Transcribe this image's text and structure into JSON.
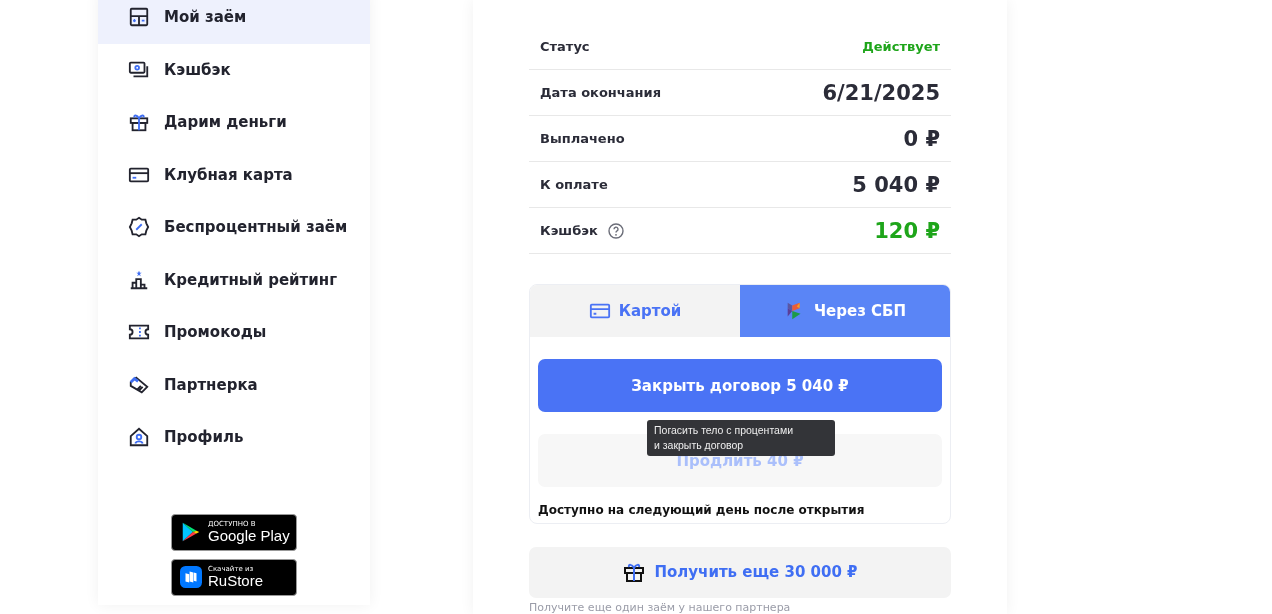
{
  "sidebar": {
    "items": [
      {
        "label": "Мой заём",
        "selected": true
      },
      {
        "label": "Кэшбэк",
        "selected": false
      },
      {
        "label": "Дарим деньги",
        "selected": false
      },
      {
        "label": "Клубная карта",
        "selected": false
      },
      {
        "label": "Беспроцентный заём",
        "selected": false
      },
      {
        "label": "Кредитный рейтинг",
        "selected": false
      },
      {
        "label": "Промокоды",
        "selected": false
      },
      {
        "label": "Партнерка",
        "selected": false
      },
      {
        "label": "Профиль",
        "selected": false
      }
    ],
    "store_badges": [
      {
        "kind": "google",
        "caption": "ДОСТУПНО В",
        "name": "Google Play"
      },
      {
        "kind": "rustore",
        "caption": "Скачайте из",
        "name": "RuStore"
      }
    ]
  },
  "loan": {
    "rows": [
      {
        "label": "Статус",
        "value": "Действует",
        "kind": "status",
        "positive": true,
        "help": false
      },
      {
        "label": "Дата окончания",
        "value": "6/21/2025",
        "kind": "amount",
        "positive": false,
        "help": false
      },
      {
        "label": "Выплачено",
        "value": "0 ₽",
        "kind": "amount",
        "positive": false,
        "help": false
      },
      {
        "label": "К оплате",
        "value": "5 040 ₽",
        "kind": "amount",
        "positive": false,
        "help": false
      },
      {
        "label": "Кэшбэк",
        "value": "120 ₽",
        "kind": "amount",
        "positive": true,
        "help": true
      }
    ],
    "payment_tabs": [
      {
        "label": "Картой",
        "kind": "card",
        "selected": false
      },
      {
        "label": "Через СБП",
        "kind": "sbp",
        "selected": true
      }
    ],
    "close_button": "Закрыть договор 5 040 ₽",
    "extend_button": {
      "label": "Продлить 40 ₽",
      "disabled": true
    },
    "tooltip": [
      "Погасить тело с процентами",
      "и закрыть договор"
    ],
    "note": "Доступно на следующий день после открытия",
    "offer_button": "Получить еще 30 000 ₽",
    "offer_caption": "Получите еще один заём у нашего партнера"
  }
}
